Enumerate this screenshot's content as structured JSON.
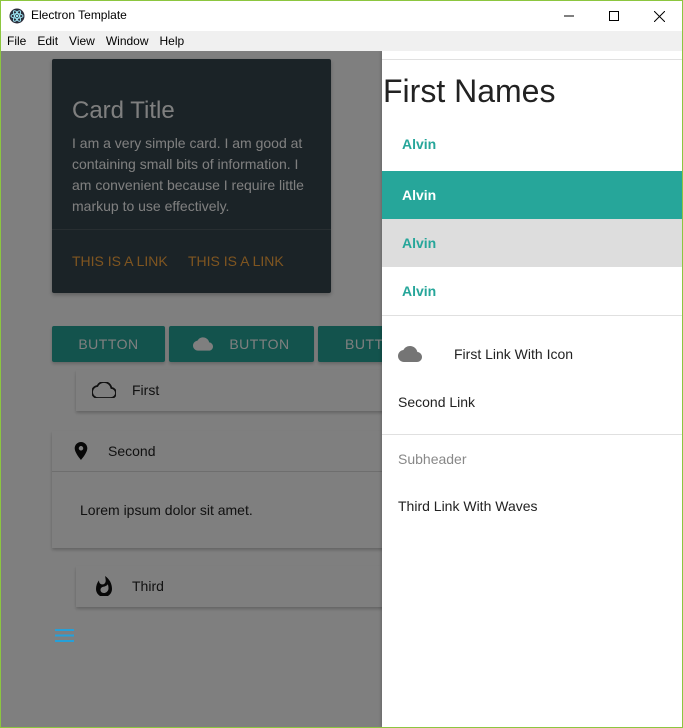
{
  "window": {
    "title": "Electron Template"
  },
  "menu": [
    "File",
    "Edit",
    "View",
    "Window",
    "Help"
  ],
  "card": {
    "title": "Card Title",
    "text": "I am a very simple card. I am good at containing small bits of information. I am convenient because I require little markup to use effectively.",
    "link1": "THIS IS A LINK",
    "link2": "THIS IS A LINK"
  },
  "buttons": {
    "btn1": "BUTTON",
    "btn2": "BUTTON",
    "btn3": "BUTT"
  },
  "collapsible": {
    "first": "First",
    "second": "Second",
    "second_body": "Lorem ipsum dolor sit amet.",
    "third": "Third"
  },
  "sidenav": {
    "title": "First Names",
    "items": [
      "Alvin",
      "Alvin",
      "Alvin",
      "Alvin"
    ],
    "link1": "First Link With Icon",
    "link2": "Second Link",
    "subheader": "Subheader",
    "link3": "Third Link With Waves"
  },
  "colors": {
    "teal": "#26a69a",
    "card_bg": "#37474f",
    "link_orange": "#ffab40"
  },
  "icons": [
    "electron-icon",
    "minimize-icon",
    "maximize-icon",
    "close-icon",
    "cloud-icon",
    "cloud-outline-icon",
    "place-icon",
    "whatshot-icon",
    "menu-icon"
  ]
}
